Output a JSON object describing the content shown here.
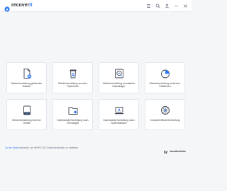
{
  "app": {
    "brand_prefix": "recover",
    "brand_suffix": "it"
  },
  "window": {
    "icons": [
      "menu-icon",
      "search-icon",
      "user-icon",
      "minimize-icon",
      "close-icon"
    ]
  },
  "cards": [
    {
      "label": "Wiederherstellung gelöschter Dateien",
      "icon": "deleted-file-icon"
    },
    {
      "label": "Wiederherstellung aus dem Papierkorb",
      "icon": "recycle-bin-icon"
    },
    {
      "label": "Wiederherstellung formatierter Datenträger",
      "icon": "hard-drive-icon"
    },
    {
      "label": "Wiederherstellung verlorener Partitionen",
      "icon": "partition-icon"
    },
    {
      "label": "Wiederherstellung externer Geräte",
      "icon": "external-device-icon"
    },
    {
      "label": "Datenwiederherstellung nach Virenangriff",
      "icon": "virus-folder-icon"
    },
    {
      "label": "Datenwiederherstellung nach Systemabsturz",
      "icon": "laptop-icon"
    },
    {
      "label": "Komplett-Wiederherstellung",
      "icon": "all-around-icon"
    }
  ],
  "footer": {
    "link_text": "Zu der Seite",
    "text": " wechseln, um WinPE-ISO-Datei bearbeiten zu erstellen",
    "logo_text": "wondershare"
  },
  "colors": {
    "accent": "#2f7bf5",
    "icon_dark": "#3b4452"
  }
}
